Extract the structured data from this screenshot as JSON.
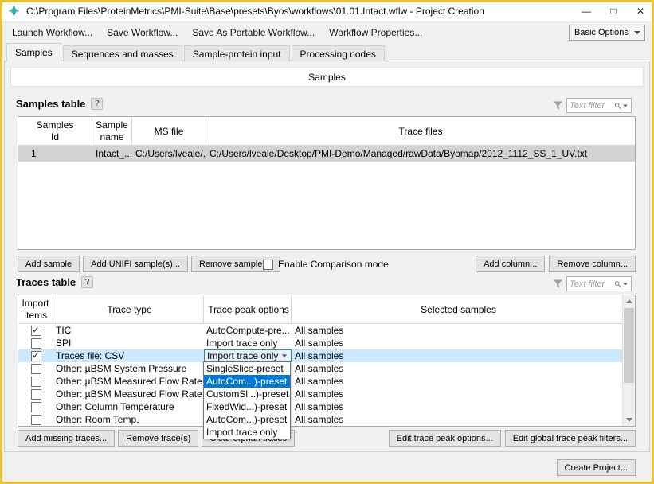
{
  "window": {
    "title": "C:\\Program Files\\ProteinMetrics\\PMI-Suite\\Base\\presets\\Byos\\workflows\\01.01.Intact.wflw - Project Creation",
    "controls": {
      "minimize": "—",
      "maximize": "□",
      "close": "✕"
    }
  },
  "toolbar": {
    "items": [
      "Launch Workflow...",
      "Save Workflow...",
      "Save As Portable Workflow...",
      "Workflow Properties..."
    ],
    "options_combo": "Basic Options"
  },
  "tabs": [
    "Samples",
    "Sequences and masses",
    "Sample-protein input",
    "Processing nodes"
  ],
  "page": {
    "header": "Samples"
  },
  "samples_section": {
    "title": "Samples table",
    "help": "?",
    "filter_placeholder": "Text filter",
    "columns": [
      "Samples Id",
      "Sample name",
      "MS file",
      "Trace files"
    ],
    "row": {
      "id": "1",
      "name": "Intact_...",
      "ms_file": "C:/Users/lveale/...",
      "trace_files": "C:/Users/lveale/Desktop/PMI-Demo/Managed/rawData/Byomap/2012_1112_SS_1_UV.txt"
    },
    "buttons": {
      "add_sample": "Add sample",
      "add_unifi": "Add UNIFI sample(s)...",
      "remove_sample": "Remove sample(s)",
      "comparison_label": "Enable Comparison mode",
      "comparison_checked": false,
      "add_column": "Add column...",
      "remove_column": "Remove column..."
    }
  },
  "traces_section": {
    "title": "Traces table",
    "help": "?",
    "filter_placeholder": "Text filter",
    "columns": [
      "Import Items",
      "Trace type",
      "Trace peak options",
      "Selected samples"
    ],
    "rows": [
      {
        "checked": true,
        "type": "TIC",
        "peak": "AutoCompute-pre...",
        "samples": "All samples"
      },
      {
        "checked": false,
        "type": "BPI",
        "peak": "Import trace only",
        "samples": "All samples"
      },
      {
        "checked": true,
        "type": "Traces file: CSV",
        "peak": "Import trace only",
        "samples": "All samples"
      },
      {
        "checked": false,
        "type": "Other: µBSM System Pressure",
        "peak": "",
        "samples": "All samples"
      },
      {
        "checked": false,
        "type": "Other: µBSM Measured Flow Rate A",
        "peak": "",
        "samples": "All samples"
      },
      {
        "checked": false,
        "type": "Other: µBSM Measured Flow Rate B",
        "peak": "",
        "samples": "All samples"
      },
      {
        "checked": false,
        "type": "Other: Column Temperature",
        "peak": "",
        "samples": "All samples"
      },
      {
        "checked": false,
        "type": "Other: Room Temp.",
        "peak": "",
        "samples": "All samples"
      }
    ],
    "dropdown": {
      "items": [
        {
          "label": "SingleSlice-preset",
          "selected": false
        },
        {
          "label": "AutoCom...)-preset",
          "selected": true
        },
        {
          "label": "CustomSl...)-preset",
          "selected": false
        },
        {
          "label": "FixedWid...)-preset",
          "selected": false
        },
        {
          "label": "AutoCom...)-preset",
          "selected": false
        },
        {
          "label": "Import trace only",
          "selected": false
        }
      ]
    },
    "buttons": {
      "add_missing": "Add missing traces...",
      "remove_trace": "Remove trace(s)",
      "clear_orphan": "Clear orphan traces",
      "edit_peak": "Edit trace peak options...",
      "edit_global": "Edit global trace peak filters..."
    }
  },
  "footer": {
    "create_project": "Create Project..."
  }
}
